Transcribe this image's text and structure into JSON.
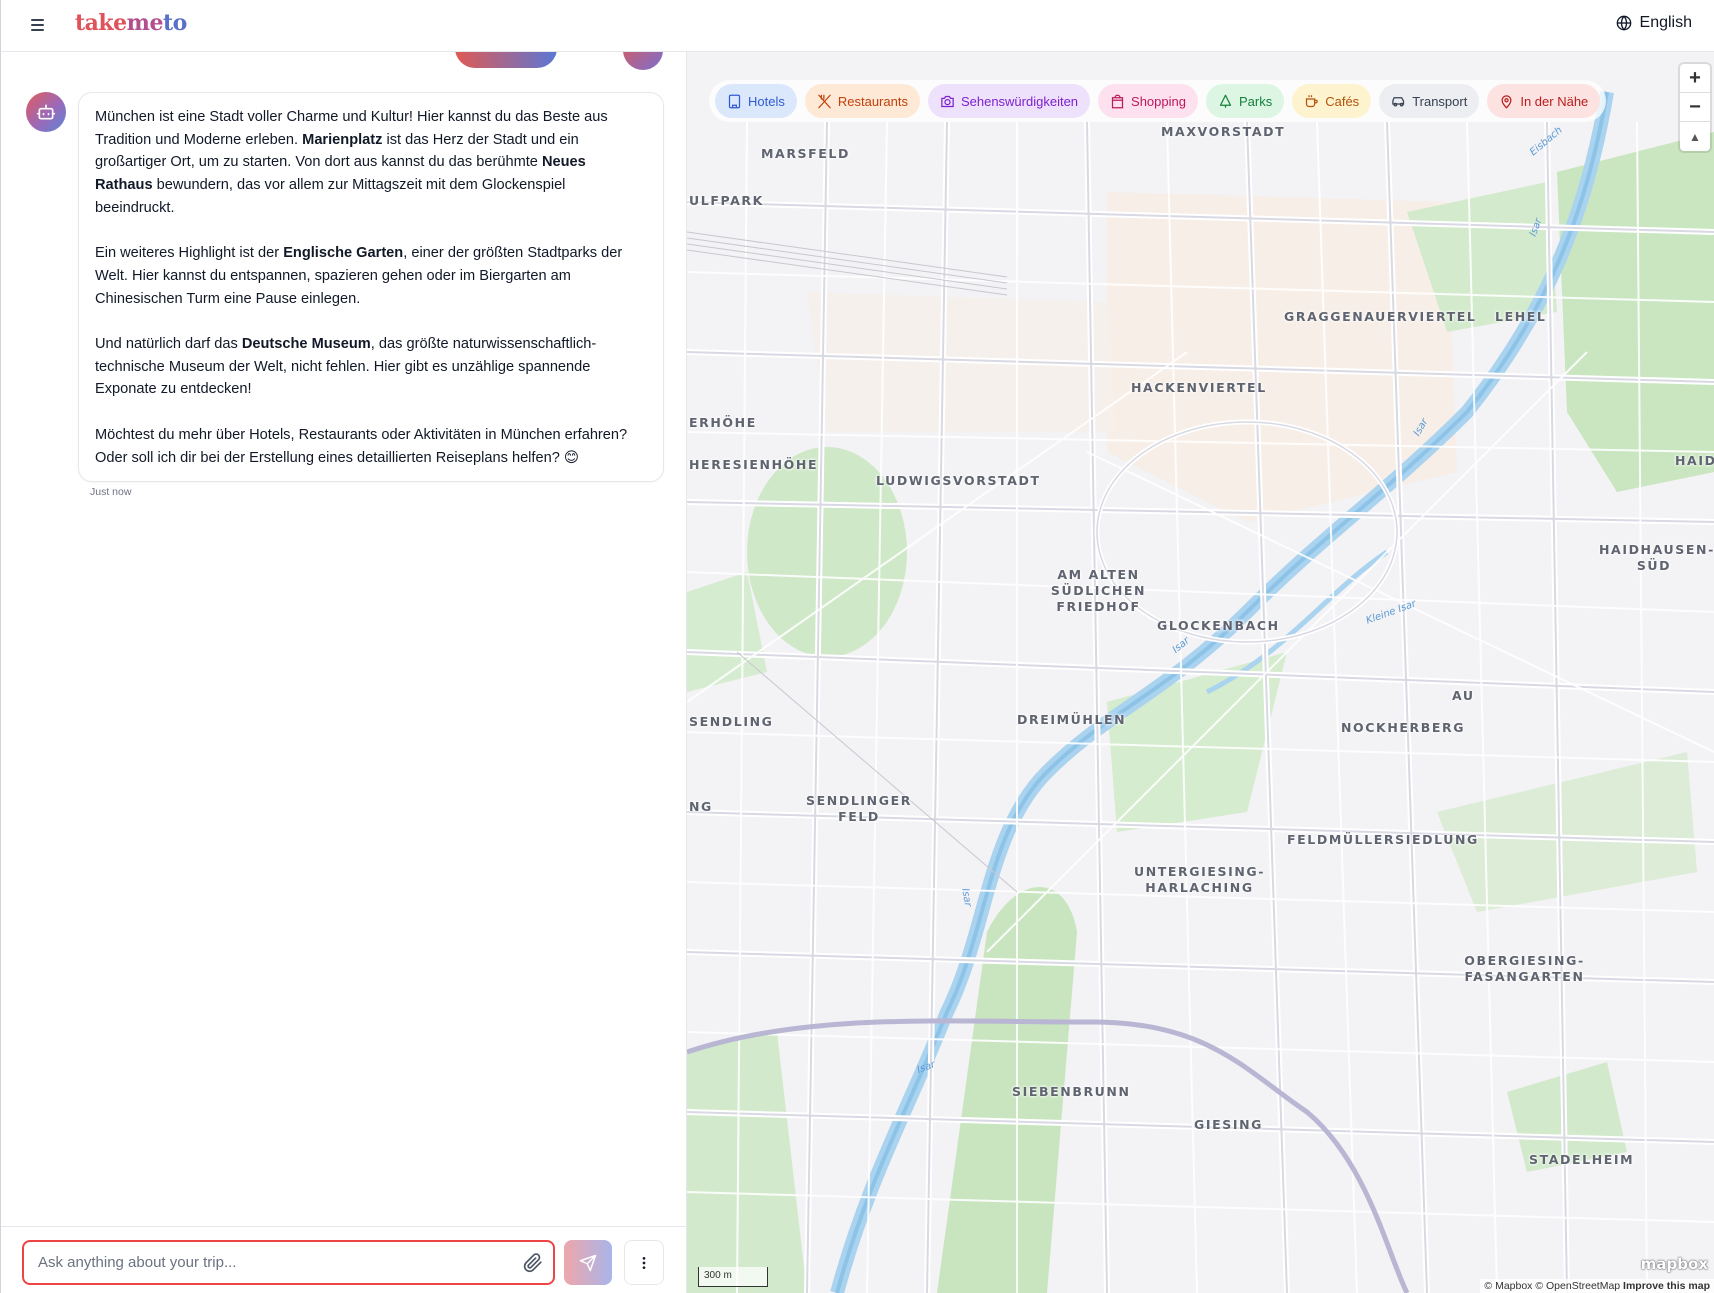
{
  "header": {
    "logo": {
      "part1": "take",
      "part2": "me",
      "part3": "to"
    },
    "language": "English"
  },
  "chat": {
    "message": {
      "p1_a": "München ist eine Stadt voller Charme und Kultur! Hier kannst du das Beste aus Tradition und Moderne erleben. ",
      "p1_b": "Marienplatz",
      "p1_c": " ist das Herz der Stadt und ein großartiger Ort, um zu starten. Von dort aus kannst du das berühmte ",
      "p1_d": "Neues Rathaus",
      "p1_e": " bewundern, das vor allem zur Mittagszeit mit dem Glockenspiel beeindruckt.",
      "p2_a": "Ein weiteres Highlight ist der ",
      "p2_b": "Englische Garten",
      "p2_c": ", einer der größten Stadtparks der Welt. Hier kannst du entspannen, spazieren gehen oder im Biergarten am Chinesischen Turm eine Pause einlegen.",
      "p3_a": "Und natürlich darf das ",
      "p3_b": "Deutsche Museum",
      "p3_c": ", das größte naturwissenschaftlich-technische Museum der Welt, nicht fehlen. Hier gibt es unzählige spannende Exponate zu entdecken!",
      "p4": "Möchtest du mehr über Hotels, Restaurants oder Aktivitäten in München erfahren? Oder soll ich dir bei der Erstellung eines detaillierten Reiseplans helfen? 😊"
    },
    "timestamp": "Just now",
    "input": {
      "placeholder": "Ask anything about your trip...",
      "value": ""
    }
  },
  "map": {
    "filters": [
      {
        "label": "Hotels",
        "icon": "building-icon",
        "bg": "#dbe7fb",
        "fg": "#2f5bd3"
      },
      {
        "label": "Restaurants",
        "icon": "utensils-icon",
        "bg": "#fde9d6",
        "fg": "#c2410c"
      },
      {
        "label": "Sehenswürdigkeiten",
        "icon": "camera-icon",
        "bg": "#eee1fb",
        "fg": "#7e22ce"
      },
      {
        "label": "Shopping",
        "icon": "shopping-bag-icon",
        "bg": "#fde1ee",
        "fg": "#be185d"
      },
      {
        "label": "Parks",
        "icon": "tree-icon",
        "bg": "#ddf5e3",
        "fg": "#15803d"
      },
      {
        "label": "Cafés",
        "icon": "coffee-icon",
        "bg": "#fdf3cf",
        "fg": "#b45309"
      },
      {
        "label": "Transport",
        "icon": "car-icon",
        "bg": "#eceef1",
        "fg": "#374151"
      },
      {
        "label": "In der Nähe",
        "icon": "map-pin-icon",
        "bg": "#fde2e2",
        "fg": "#b91c1c"
      }
    ],
    "zoom": {
      "in": "+",
      "out": "−",
      "compass": "▲"
    },
    "places": [
      "MAXVORSTADT",
      "MARSFELD",
      "ULFPARK",
      "GRAGGENAUERVIERTEL",
      "LEHEL",
      "HACKENVIERTEL",
      "ERHÖHE",
      "HERESIENHÖHE",
      "LUDWIGSVORSTADT",
      "AM ALTEN",
      "SÜDLICHEN",
      "FRIEDHOF",
      "GLOCKENBACH",
      "HAID",
      "HAIDHAUSEN-",
      "SÜD",
      "AU",
      "SENDLING",
      "DREIMÜHLEN",
      "NOCKHERBERG",
      "NG",
      "SENDLINGER",
      "FELD",
      "FELDMÜLLERSIEDLUNG",
      "UNTERGIESING-",
      "HARLACHING",
      "OBERGIESING-",
      "FASANGARTEN",
      "SIEBENBRUNN",
      "GIESING",
      "STADELHEIM"
    ],
    "rivers": [
      "Isar",
      "Eisbach",
      "Kleine Isar"
    ],
    "scale": "300 m",
    "attribution": {
      "text": "© Mapbox © OpenStreetMap ",
      "link": "Improve this map"
    },
    "brand": "mapbox"
  }
}
